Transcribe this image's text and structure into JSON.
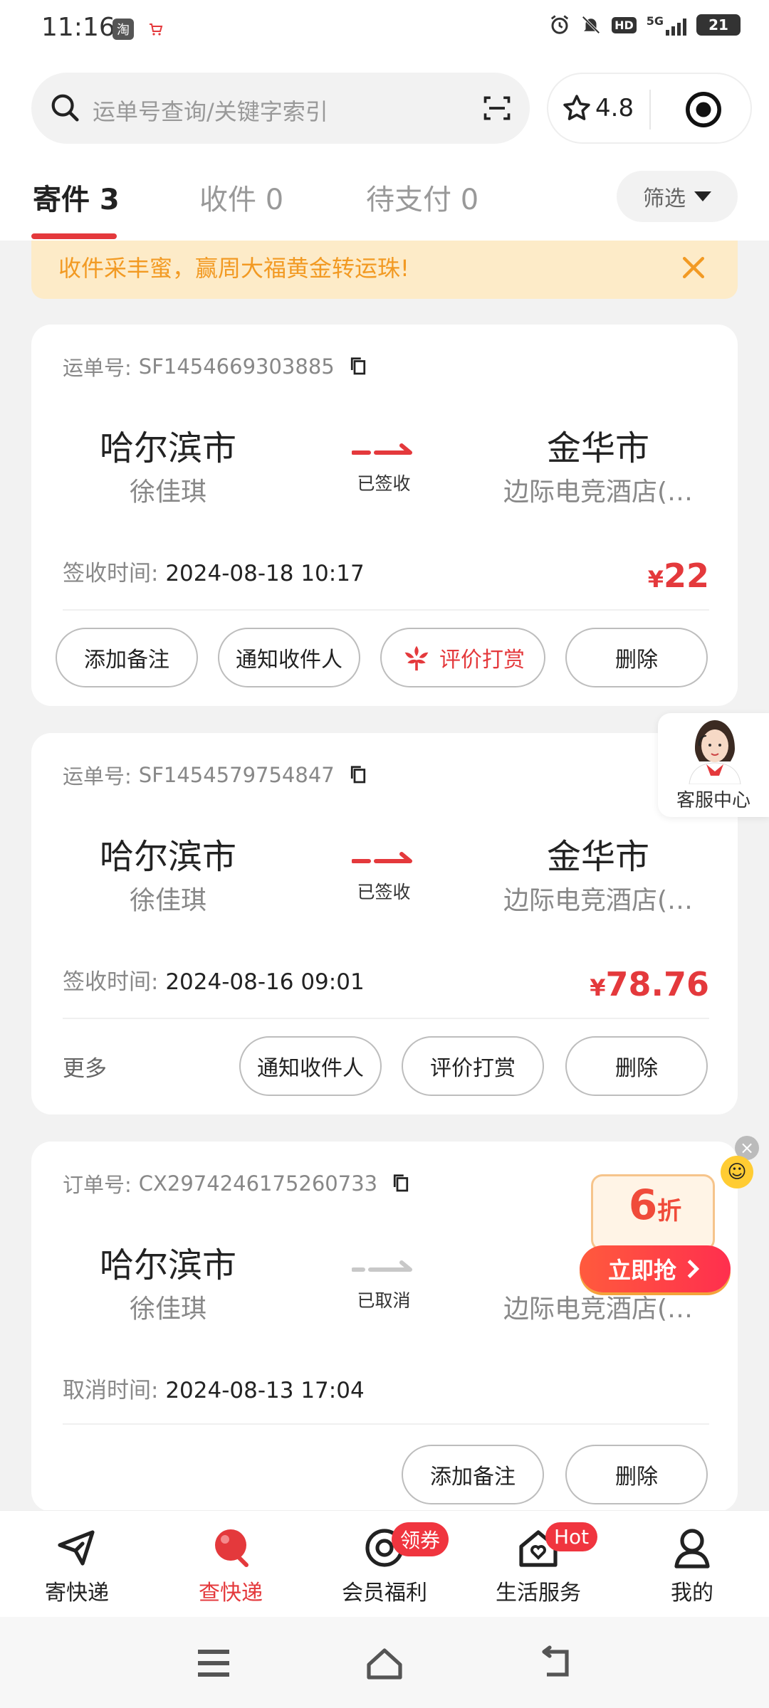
{
  "status_bar": {
    "time": "11:16",
    "icons": [
      "taobao-icon",
      "cart-icon",
      "alarm-icon",
      "mute-icon",
      "hd-icon",
      "signal-5g-icon",
      "battery-icon"
    ],
    "battery": "21",
    "network": "5G"
  },
  "search": {
    "placeholder": "运单号查询/关键字索引"
  },
  "rating": {
    "value": "4.8"
  },
  "tabs": [
    {
      "label": "寄件 3",
      "active": true
    },
    {
      "label": "收件 0",
      "active": false
    },
    {
      "label": "待支付 0",
      "active": false
    }
  ],
  "filter": {
    "label": "筛选"
  },
  "promo_banner": {
    "text": "收件采丰蜜，赢周大福黄金转运珠!"
  },
  "orders": [
    {
      "id_label": "运单号:",
      "id": "SF1454669303885",
      "from_city": "哈尔滨市",
      "from_person": "徐佳琪",
      "status": "已签收",
      "to_city": "金华市",
      "to_person": "边际电竞酒店(…",
      "time_label": "签收时间:",
      "time": "2024-08-18 10:17",
      "price_symbol": "¥",
      "price": "22",
      "buttons": [
        "添加备注",
        "通知收件人",
        "评价打赏",
        "删除"
      ]
    },
    {
      "id_label": "运单号:",
      "id": "SF1454579754847",
      "from_city": "哈尔滨市",
      "from_person": "徐佳琪",
      "status": "已签收",
      "to_city": "金华市",
      "to_person": "边际电竞酒店(…",
      "time_label": "签收时间:",
      "time": "2024-08-16 09:01",
      "price_symbol": "¥",
      "price": "78.76",
      "more": "更多",
      "buttons": [
        "通知收件人",
        "评价打赏",
        "删除"
      ]
    },
    {
      "id_label": "订单号:",
      "id": "CX2974246175260733",
      "from_city": "哈尔滨市",
      "from_person": "徐佳琪",
      "status": "已取消",
      "to_city": "金",
      "to_person": "边际电竞酒店(…",
      "time_label": "取消时间:",
      "time": "2024-08-13 17:04",
      "buttons": [
        "添加备注",
        "删除"
      ]
    }
  ],
  "customer_service": {
    "label": "客服中心"
  },
  "promo_float": {
    "discount_number": "6",
    "discount_unit": "折",
    "button": "立即抢"
  },
  "bottom_nav": [
    {
      "label": "寄快递",
      "icon": "send-plane-icon",
      "active": false
    },
    {
      "label": "查快递",
      "icon": "track-pin-icon",
      "active": true
    },
    {
      "label": "会员福利",
      "icon": "member-coin-icon",
      "active": false,
      "badge": "领券"
    },
    {
      "label": "生活服务",
      "icon": "home-heart-icon",
      "active": false,
      "badge": "Hot"
    },
    {
      "label": "我的",
      "icon": "user-icon",
      "active": false
    }
  ],
  "colors": {
    "accent": "#e4393c",
    "promo_bg": "#fdebc8",
    "promo_text": "#f29a23",
    "page_bg": "#f2f2f2"
  }
}
